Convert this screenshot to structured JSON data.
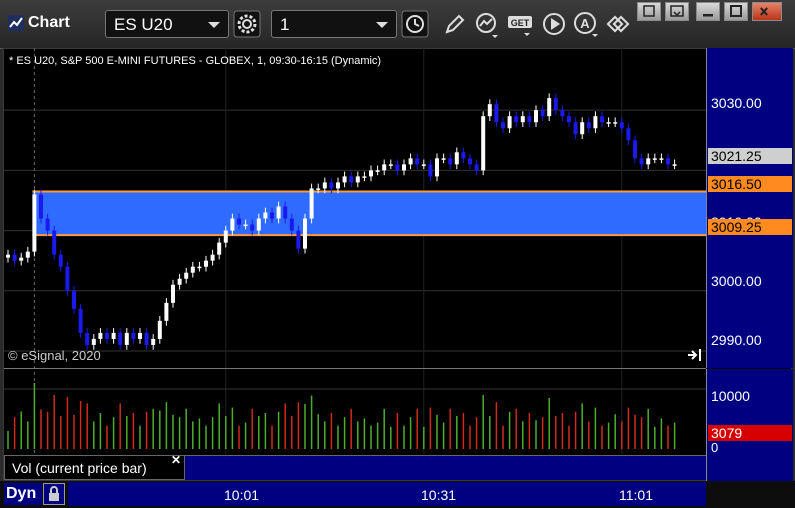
{
  "window": {
    "title": "Chart",
    "symbol_combo": "ES U20",
    "interval_combo": "1"
  },
  "chart_header": "* ES U20, S&P 500 E-MINI FUTURES - GLOBEX, 1, 09:30-16:15 (Dynamic)",
  "copyright": "© eSignal, 2020",
  "volume_panel_label": "Vol (current price bar)",
  "mode_label": "Dyn",
  "colors": {
    "up": "#ffffff",
    "down": "#1a1aee",
    "box": "#2f6bff",
    "box_line": "#ff9a3c",
    "vol_up": "#4caf2a",
    "vol_down": "#d12a1a",
    "axis_bg": "#000080"
  },
  "tags": {
    "last": "3021.25",
    "box_high": "3016.50",
    "box_low": "3009.25",
    "volume": "3079"
  },
  "chart_data": {
    "type": "candlestick",
    "y_ticks": [
      "3030.00",
      "3020.00",
      "3010.00",
      "3000.00",
      "2990.00"
    ],
    "y_tick_values": [
      3030,
      3020,
      3010,
      3000,
      2990
    ],
    "ylim": [
      2988,
      3039
    ],
    "x_ticks": [
      "10:01",
      "10:31",
      "11:01"
    ],
    "x_tick_index": [
      33,
      63,
      93
    ],
    "volume_ticks": [
      "10000",
      "0"
    ],
    "volume_ylim": [
      0,
      13000
    ],
    "box": {
      "high": 3016.5,
      "low": 3009.25,
      "start_index": 4
    },
    "closes": [
      3006,
      3005,
      3005.5,
      3006.5,
      3016,
      3012,
      3010,
      3006,
      3004,
      3000,
      2997,
      2993,
      2991,
      2992,
      2993,
      2992,
      2993,
      2991,
      2993,
      2992,
      2993,
      2991,
      2992,
      2995,
      2998,
      3001,
      3002,
      3003,
      3004,
      3004,
      3005,
      3006,
      3008,
      3010,
      3012,
      3011,
      3011,
      3010,
      3012,
      3013,
      3012,
      3014,
      3012,
      3010,
      3007,
      3012,
      3017,
      3017,
      3018,
      3017,
      3018,
      3019,
      3018,
      3019,
      3019,
      3020,
      3020,
      3021,
      3021,
      3020,
      3021,
      3022,
      3021,
      3021,
      3019,
      3022,
      3022,
      3021,
      3023,
      3022,
      3021,
      3020,
      3029,
      3031,
      3028,
      3027,
      3029,
      3028,
      3029,
      3028,
      3030,
      3029,
      3032,
      3030,
      3029,
      3028,
      3026,
      3028,
      3027,
      3029,
      3028,
      3028,
      3028,
      3027,
      3025,
      3022,
      3021,
      3022,
      3022,
      3022,
      3021,
      3021
    ]
  }
}
